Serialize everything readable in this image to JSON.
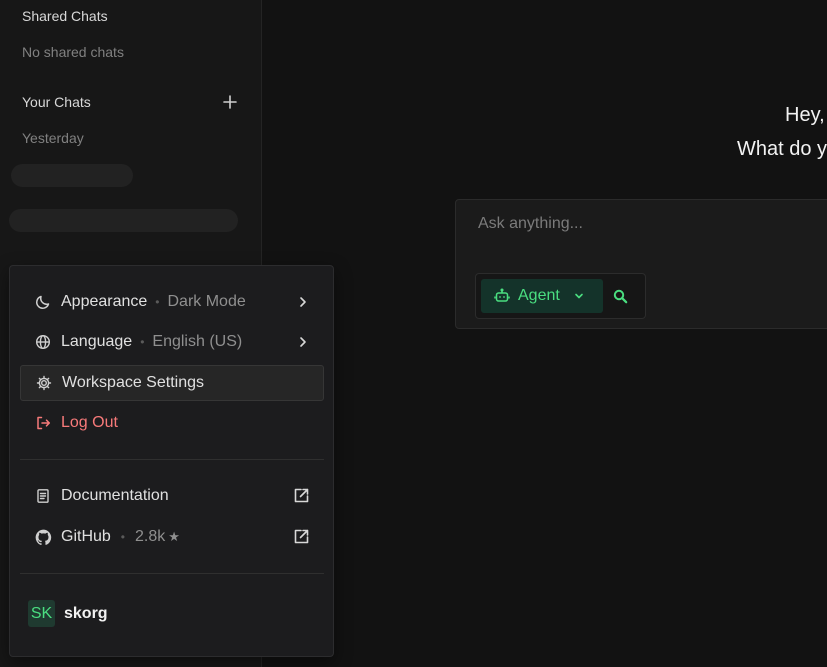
{
  "sidebar": {
    "shared_heading": "Shared Chats",
    "shared_empty": "No shared chats",
    "your_heading": "Your Chats",
    "group_label": "Yesterday"
  },
  "main": {
    "greeting_line1": "Hey,",
    "greeting_line2": "What do y",
    "composer_placeholder": "Ask anything...",
    "agent_label": "Agent"
  },
  "menu": {
    "appearance_label": "Appearance",
    "appearance_value": "Dark Mode",
    "language_label": "Language",
    "language_value": "English (US)",
    "workspace_label": "Workspace Settings",
    "logout_label": "Log Out",
    "docs_label": "Documentation",
    "github_label": "GitHub",
    "github_stars": "2.8k",
    "dot": "•"
  },
  "user": {
    "initials": "SK",
    "name": "skorg"
  },
  "icons": {
    "appearance": "moon-icon",
    "language": "globe-icon",
    "workspace": "gear-icon",
    "logout": "logout-icon",
    "docs": "document-icon",
    "github": "github-icon",
    "external": "external-link-icon",
    "agent": "robot-icon",
    "search": "search-icon",
    "add": "plus-icon"
  },
  "colors": {
    "accent": "#4ade80",
    "danger": "#f77a7a",
    "background": "#121212"
  }
}
